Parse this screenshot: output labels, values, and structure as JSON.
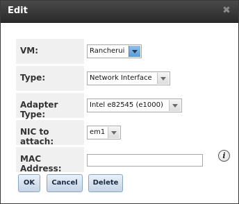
{
  "dialog": {
    "title": "Edit",
    "close_icon": "close-icon"
  },
  "form": {
    "fields": [
      {
        "label": "VM:",
        "type": "select",
        "value": "Rancherui"
      },
      {
        "label": "Type:",
        "type": "select",
        "value": "Network Interface"
      },
      {
        "label": "Adapter Type:",
        "type": "select",
        "value": "Intel e82545 (e1000)"
      },
      {
        "label": "NIC to attach:",
        "type": "select",
        "value": "em1"
      },
      {
        "label": "MAC Address:",
        "type": "text",
        "value": ""
      }
    ],
    "info_icon": "info-icon"
  },
  "buttons": {
    "ok": "OK",
    "cancel": "Cancel",
    "delete": "Delete"
  }
}
